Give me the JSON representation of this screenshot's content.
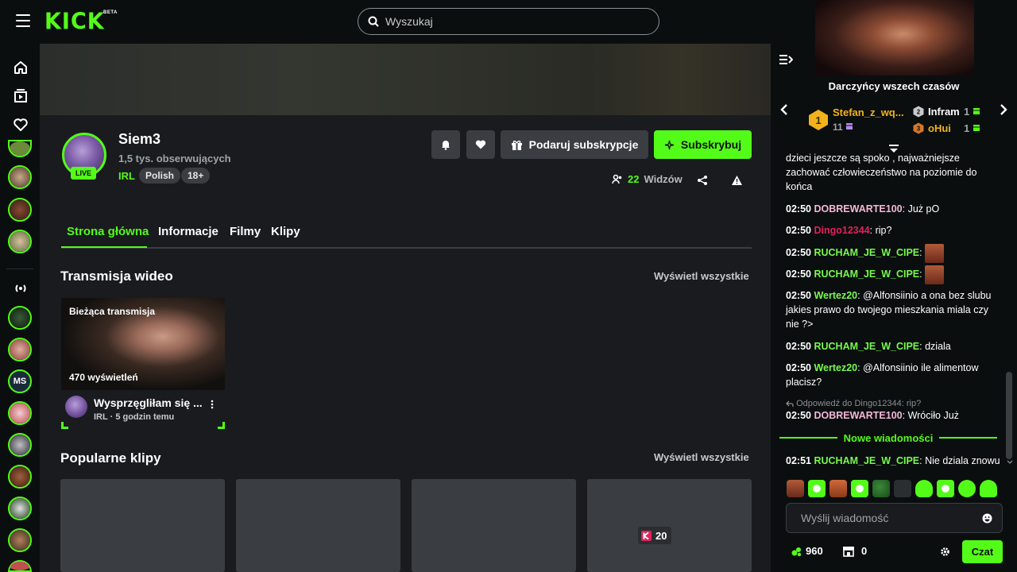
{
  "app": {
    "logo": "KICK",
    "logo_badge": "BETA"
  },
  "search": {
    "placeholder": "Wyszukaj"
  },
  "channel": {
    "name": "Siem3",
    "followers": "1,5 tys. obserwujących",
    "category": "IRL",
    "tags": [
      "Polish",
      "18+"
    ],
    "live_label": "LIVE",
    "viewers_count": "22",
    "viewers_label": "Widzów"
  },
  "buttons": {
    "gift": "Podaruj subskrypcje",
    "subscribe": "Subskrybuj"
  },
  "tabs": [
    "Strona główna",
    "Informacje",
    "Filmy",
    "Klipy"
  ],
  "sections": {
    "videos_title": "Transmisja wideo",
    "clips_title": "Popularne klipy",
    "see_all": "Wyświetl wszystkie"
  },
  "video": {
    "badge": "Bieżąca transmisja",
    "views": "470 wyświetleń",
    "title": "Wysprzęgliłam się ...",
    "category": "IRL",
    "time": "5 godzin temu"
  },
  "clips": {
    "badge_count": "20"
  },
  "chat": {
    "top_gifters_title": "Darczyńcy wszech czasów",
    "gifters": [
      {
        "rank": "1",
        "name": "Stefan_z_wq...",
        "count": "11"
      },
      {
        "rank": "2",
        "name": "Infram",
        "count": "1"
      },
      {
        "rank": "3",
        "name": "oHui",
        "count": "1"
      }
    ],
    "partial_message": "dzieci jeszcze są spoko , najważniejsze zachować człowieczeństwo na poziomie do końca",
    "messages": [
      {
        "time": "02:50",
        "user": "DOBREWARTE100",
        "color": "#f4b8d8",
        "text": "Już pO"
      },
      {
        "time": "02:50",
        "user": "Dingo12344",
        "color": "#e0225a",
        "text": "rip?"
      },
      {
        "time": "02:50",
        "user": "RUCHAM_JE_W_CIPE",
        "color": "#75fb4c",
        "text": ""
      },
      {
        "time": "02:50",
        "user": "RUCHAM_JE_W_CIPE",
        "color": "#75fb4c",
        "text": ""
      },
      {
        "time": "02:50",
        "user": "Wertez20",
        "color": "#75fb4c",
        "text": "@Alfonsiinio a ona bez slubu jakies prawo do twojego mieszkania miala czy nie ?>"
      },
      {
        "time": "02:50",
        "user": "RUCHAM_JE_W_CIPE",
        "color": "#75fb4c",
        "text": "dziala"
      },
      {
        "time": "02:50",
        "user": "Wertez20",
        "color": "#75fb4c",
        "text": "@Alfonsiinio ile alimentow placisz?"
      }
    ],
    "reply_ref": "Odpowiedź do Dingo12344: rip?",
    "reply_message": {
      "time": "02:50",
      "user": "DOBREWARTE100",
      "color": "#f4b8d8",
      "text": "Wróciło Już"
    },
    "new_messages_label": "Nowe wiadomości",
    "new_message": {
      "time": "02:51",
      "user": "RUCHAM_JE_W_CIPE",
      "color": "#75fb4c",
      "text": "Nie dziala znowu"
    },
    "input_placeholder": "Wyślij wiadomość",
    "points": "960",
    "store_count": "0",
    "send_label": "Czat"
  },
  "colors": {
    "accent": "#53fc18",
    "background": "#0b0e0f",
    "panel": "#191b1f"
  }
}
